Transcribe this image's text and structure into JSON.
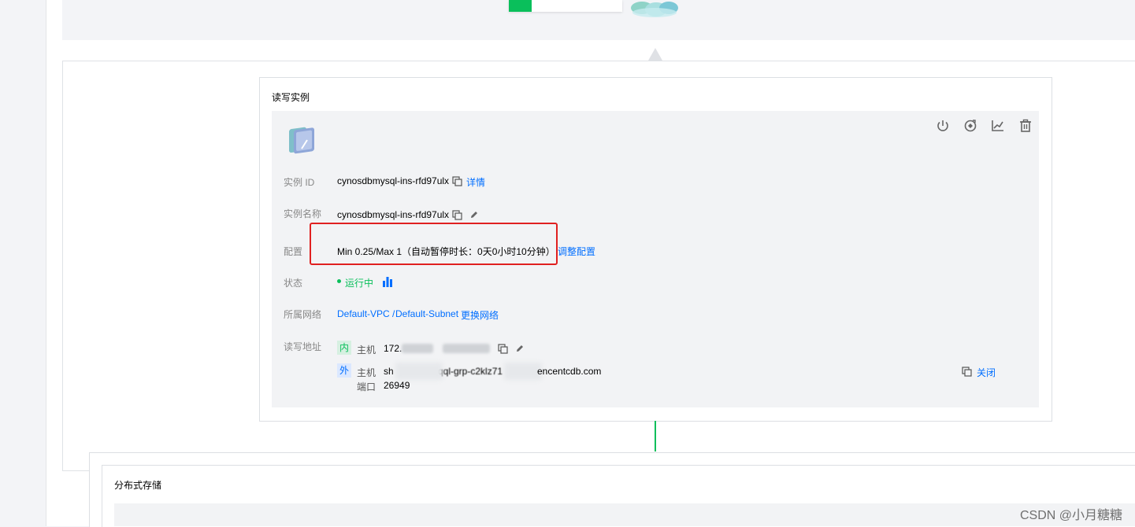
{
  "top": {
    "progress_fraction": 0.2
  },
  "rw_instance": {
    "title": "读写实例",
    "instance_id_label": "实例 ID",
    "instance_id": "cynosdbmysql-ins-rfd97ulx",
    "details_link": "详情",
    "instance_name_label": "实例名称",
    "instance_name": "cynosdbmysql-ins-rfd97ulx",
    "config_label": "配置",
    "config_value": "Min 0.25/Max 1（自动暂停时长：0天0小时10分钟）",
    "adjust_link": "调整配置",
    "status_label": "状态",
    "status_value": "运行中",
    "network_label": "所属网络",
    "vpc": "Default-VPC",
    "separator": "/",
    "subnet": "Default-Subnet",
    "change_network_link": "更换网络",
    "rw_addr_label": "读写地址",
    "internal_tag": "内",
    "external_tag": "外",
    "host_label": "主机",
    "internal_host": "172.",
    "external_host_prefix": "sh",
    "external_host_mid": "qql-grp-c2klz71",
    "external_host_suffix": "encentcdb.com",
    "port_label": "端口",
    "port": "26949",
    "close_link": "关闭"
  },
  "storage": {
    "title": "分布式存储"
  },
  "watermark": "CSDN @小月糖糖",
  "colors": {
    "accent": "#006eff",
    "success": "#0abf5b",
    "highlight": "#e02020"
  },
  "icons": [
    "power-icon",
    "restart-icon",
    "monitor-chart-icon",
    "delete-icon",
    "copy-icon",
    "edit-icon",
    "bar-chart-icon",
    "instance-icon"
  ]
}
